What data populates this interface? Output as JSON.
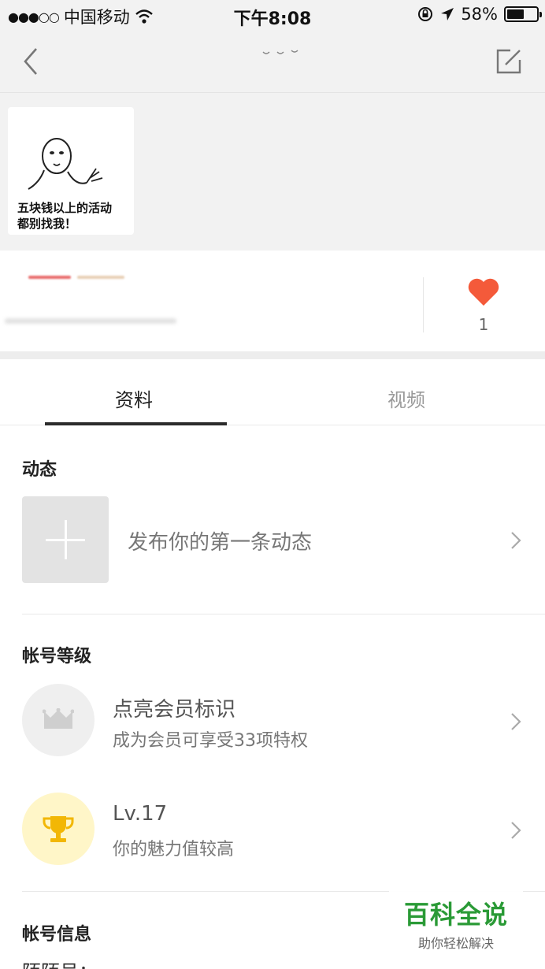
{
  "status_bar": {
    "signal": "●●●○○",
    "carrier": "中国移动",
    "time": "下午8:08",
    "battery_percent": "58%",
    "battery_level": 0.58
  },
  "nav": {
    "back_icon": "chevron-left-icon",
    "edit_icon": "edit-icon"
  },
  "avatar": {
    "caption": "五块钱以上的活动\n都别找我！"
  },
  "like": {
    "icon": "heart-icon",
    "color": "#f45a3a",
    "count": "1"
  },
  "tabs": [
    {
      "label": "资料",
      "active": true
    },
    {
      "label": "视频",
      "active": false
    }
  ],
  "sections": {
    "moments": {
      "title": "动态",
      "post_prompt": "发布你的第一条动态"
    },
    "level": {
      "title": "帐号等级",
      "vip_title": "点亮会员标识",
      "vip_sub": "成为会员可享受33项特权",
      "lv_title": "Lv.17",
      "lv_sub": "你的魅力值较高"
    },
    "account": {
      "title": "帐号信息",
      "partial_line": "陌陌号："
    }
  },
  "watermark": {
    "title": "百科全说",
    "sub": "助你轻松解决",
    "color": "#2a9a36"
  }
}
